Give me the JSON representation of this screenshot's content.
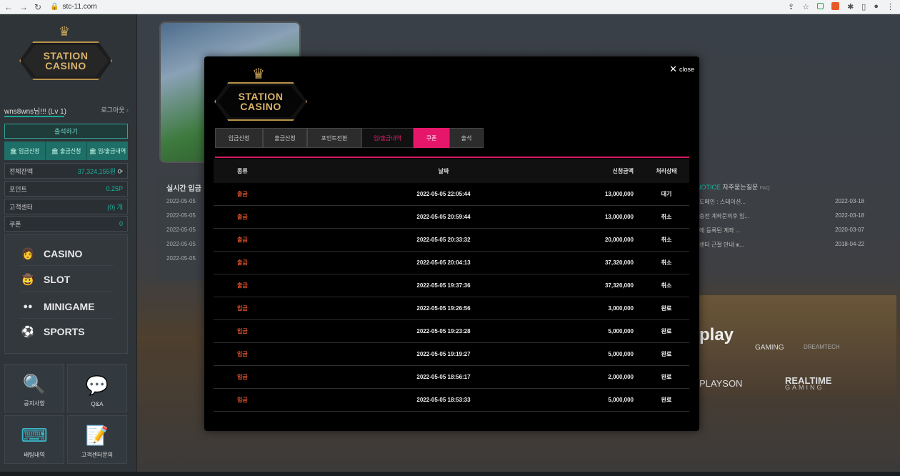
{
  "browser": {
    "url": "stc-11.com"
  },
  "brand": {
    "line1": "STATION",
    "line2": "CASINO"
  },
  "sidebar": {
    "username": "wns8wns님!!! (Lv 1)",
    "logout": "로그아웃",
    "attend": "출석하기",
    "quick": [
      "입금신청",
      "출금신청",
      "입/출금내역"
    ],
    "balance_label": "전체잔액",
    "balance_value": "37,324,155원",
    "point_label": "포인트",
    "point_value": "0.25P",
    "support_label": "고객센터",
    "support_value": "(0) 개",
    "coupon_label": "쿠폰",
    "coupon_value": "0",
    "menu": [
      "CASINO",
      "SLOT",
      "MINIGAME",
      "SPORTS"
    ],
    "tiles": [
      "공지사항",
      "Q&A",
      "배팅내역",
      "고객센터문의"
    ]
  },
  "background": {
    "live_title": "실시간 입금",
    "live_dates": [
      "2022-05-05",
      "2022-05-05",
      "2022-05-05",
      "2022-05-05",
      "2022-05-05"
    ],
    "notice_label": "NOTICE",
    "faq_label": "자주묻는질문",
    "faq_tag": "FAQ",
    "notices": [
      {
        "title": "도메인 : 스테이션...",
        "date": "2022-03-18"
      },
      {
        "title": "충전 계좌문의후 입...",
        "date": "2022-03-18"
      },
      {
        "title": "에 등록된 계좌 ...",
        "date": "2020-03-07"
      },
      {
        "title": "센터 근절 안내 ж...",
        "date": "2018-04-22"
      }
    ],
    "providers": [
      "play",
      "GAMING",
      "DREAMTECH",
      "PLAYSON",
      "REALTIME",
      "GAMING"
    ]
  },
  "modal": {
    "close_label": "close",
    "tabs": [
      "입금신청",
      "출금신청",
      "포인트전환",
      "입/출금내역",
      "쿠폰",
      "출석"
    ],
    "columns": [
      "종류",
      "날짜",
      "신청금액",
      "처리상태"
    ],
    "rows": [
      {
        "type": "출금",
        "date": "2022-05-05 22:05:44",
        "amount": "13,000,000",
        "status": "대기"
      },
      {
        "type": "출금",
        "date": "2022-05-05 20:59:44",
        "amount": "13,000,000",
        "status": "취소"
      },
      {
        "type": "출금",
        "date": "2022-05-05 20:33:32",
        "amount": "20,000,000",
        "status": "취소"
      },
      {
        "type": "출금",
        "date": "2022-05-05 20:04:13",
        "amount": "37,320,000",
        "status": "취소"
      },
      {
        "type": "출금",
        "date": "2022-05-05 19:37:36",
        "amount": "37,320,000",
        "status": "취소"
      },
      {
        "type": "입금",
        "date": "2022-05-05 19:26:56",
        "amount": "3,000,000",
        "status": "완료"
      },
      {
        "type": "입금",
        "date": "2022-05-05 19:23:28",
        "amount": "5,000,000",
        "status": "완료"
      },
      {
        "type": "입금",
        "date": "2022-05-05 19:19:27",
        "amount": "5,000,000",
        "status": "완료"
      },
      {
        "type": "입금",
        "date": "2022-05-05 18:56:17",
        "amount": "2,000,000",
        "status": "완료"
      },
      {
        "type": "입금",
        "date": "2022-05-05 18:53:33",
        "amount": "5,000,000",
        "status": "완료"
      }
    ]
  },
  "colors": {
    "accent_pink": "#e6176b",
    "accent_teal": "#19b3a0",
    "type_text": "#e8552b",
    "gold": "#b8924b"
  }
}
